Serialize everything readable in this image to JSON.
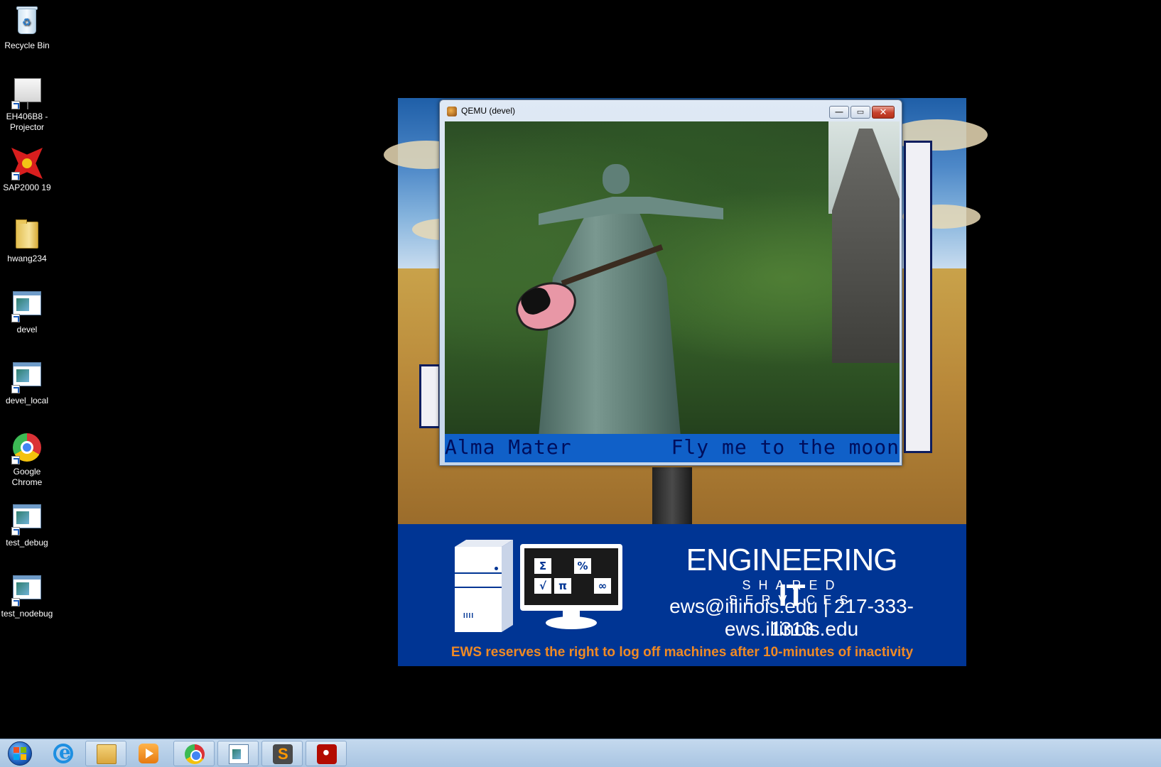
{
  "desktop": {
    "icons": [
      {
        "label": "Recycle Bin",
        "icon": "recycle-bin-icon"
      },
      {
        "label": "EH406B8 - Projector",
        "icon": "projector-icon"
      },
      {
        "label": "SAP2000 19",
        "icon": "sap2000-icon"
      },
      {
        "label": "hwang234",
        "icon": "folder-icon"
      },
      {
        "label": "devel",
        "icon": "app-shortcut-icon"
      },
      {
        "label": "devel_local",
        "icon": "app-shortcut-icon"
      },
      {
        "label": "Google Chrome",
        "icon": "chrome-icon"
      },
      {
        "label": "test_debug",
        "icon": "app-shortcut-icon"
      },
      {
        "label": "test_nodebug",
        "icon": "app-shortcut-icon"
      }
    ]
  },
  "wallpaper": {
    "brand_main": "ENGINEERING",
    "brand_bold": "IT",
    "brand_sub": "SHARED SERVICES",
    "contact": "ews@illinois.edu | 217-333-1313",
    "website": "ews.illinois.edu",
    "notice": "EWS reserves the right to log off machines after 10-minutes of inactivity",
    "keys": [
      "Σ",
      "%",
      "√",
      "π",
      "∞"
    ],
    "colors": {
      "banner": "#003594",
      "notice": "#f08a24"
    }
  },
  "qemu": {
    "title": "QEMU (devel)",
    "status_left": "Alma Mater",
    "status_right": "Fly me to the moon",
    "status_bar_color": "#1060c8",
    "status_text_color": "#000e5c"
  },
  "window_controls": {
    "minimize": "—",
    "maximize": "▭",
    "close": "✕"
  },
  "taskbar": {
    "items": [
      {
        "name": "start",
        "icon": "windows-start-icon"
      },
      {
        "name": "internet-explorer",
        "icon": "internet-explorer-icon"
      },
      {
        "name": "windows-explorer",
        "icon": "folder-icon"
      },
      {
        "name": "media-player",
        "icon": "media-player-icon"
      },
      {
        "name": "google-chrome",
        "icon": "chrome-icon"
      },
      {
        "name": "qemu",
        "icon": "app-window-icon"
      },
      {
        "name": "sublime-text",
        "icon": "sublime-text-icon"
      },
      {
        "name": "acrobat",
        "icon": "acrobat-icon"
      }
    ]
  }
}
